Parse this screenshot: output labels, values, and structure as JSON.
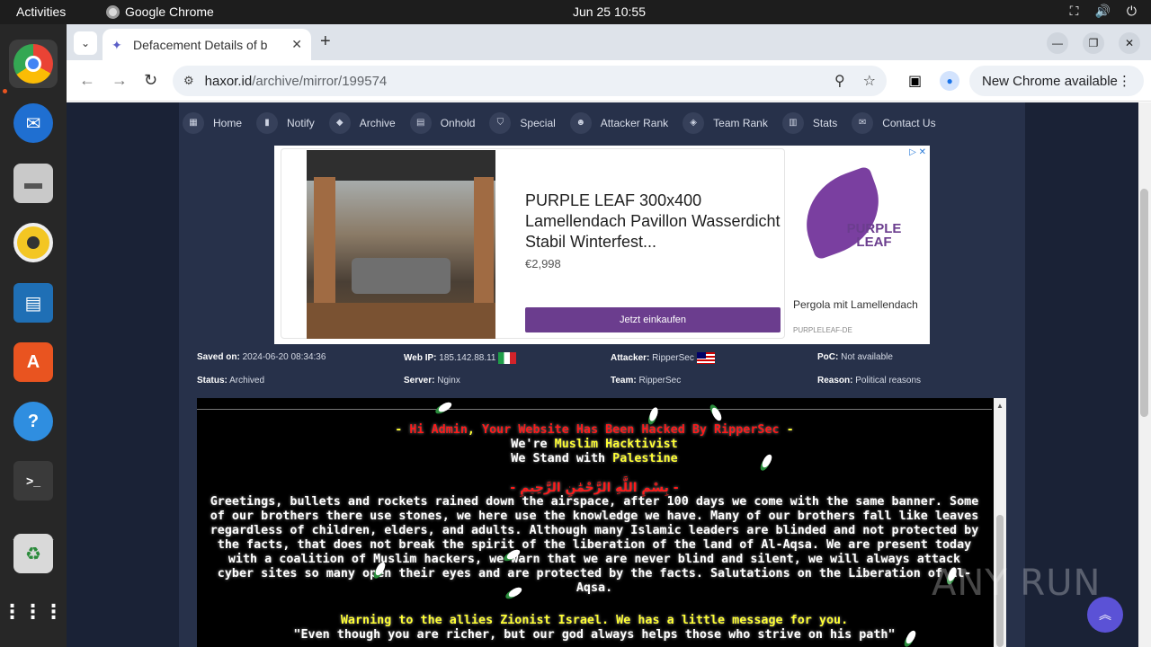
{
  "topbar": {
    "activities": "Activities",
    "app_name": "Google Chrome",
    "datetime": "Jun 25  10:55"
  },
  "dock": {
    "items": [
      "chrome",
      "thunderbird",
      "files",
      "rhythmbox",
      "writer",
      "app-center",
      "help",
      "terminal",
      "trash",
      "app-grid"
    ]
  },
  "browser": {
    "tab_title": "Defacement Details of b",
    "url_host": "haxor.id",
    "url_path": "/archive/mirror/199574",
    "new_chrome": "New Chrome available"
  },
  "menu": {
    "items": [
      "Home",
      "Notify",
      "Archive",
      "Onhold",
      "Special",
      "Attacker Rank",
      "Team Rank",
      "Stats",
      "Contact Us"
    ]
  },
  "ad": {
    "title": "PURPLE LEAF 300x400 Lamellendach Pavillon Wasserdicht Stabil Winterfest...",
    "price": "€2,998",
    "cta": "Jetzt einkaufen",
    "brand": "PURPLE LEAF",
    "side_text": "Pergola mit Lamellendach",
    "side_domain": "PURPLELEAF-DE"
  },
  "info": {
    "saved_label": "Saved on:",
    "saved_value": "2024-06-20 08:34:36",
    "webip_label": "Web IP:",
    "webip_value": "185.142.88.11",
    "attacker_label": "Attacker:",
    "attacker_value": "RipperSec",
    "poc_label": "PoC:",
    "poc_value": "Not available",
    "status_label": "Status:",
    "status_value": "Archived",
    "server_label": "Server:",
    "server_value": "Nginx",
    "team_label": "Team:",
    "team_value": "RipperSec",
    "reason_label": "Reason:",
    "reason_value": "Political reasons"
  },
  "mirror": {
    "line1_dash": "- ",
    "line1_a": "Hi Admin",
    "line1_comma": ", ",
    "line1_b": "Your Website Has Been Hacked By RipperSec",
    "line1_end": " -",
    "line2_a": "We're ",
    "line2_b": "Muslim Hacktivist",
    "line3_a": "We Stand with ",
    "line3_b": "Palestine",
    "bismillah": "- بِسْمِ اللَّهِ الرَّحْمَٰنِ الرَّحِيمِ -",
    "para1": "Greetings, bullets and rockets rained down the airspace, after 100 days we come with the same banner. Some of our brothers there use stones, we here use the knowledge we have. Many of our brothers fall like leaves regardless of children, elders, and adults. Although many Islamic leaders are blinded and not protected by the facts, that does not break the spirit of the liberation of the land of Al-Aqsa. We are present today with a coalition of Muslim hackers, we warn that we are never blind and silent, we will always attack cyber sites so many open their eyes and are protected by the facts. Salutations on the Liberation of Al-Aqsa.",
    "warning": "Warning to the allies Zionist Israel. We has a little message for you.",
    "quote": "\"Even though you are richer, but our god always helps those who strive on his path\""
  },
  "watermark": "ANY RUN"
}
